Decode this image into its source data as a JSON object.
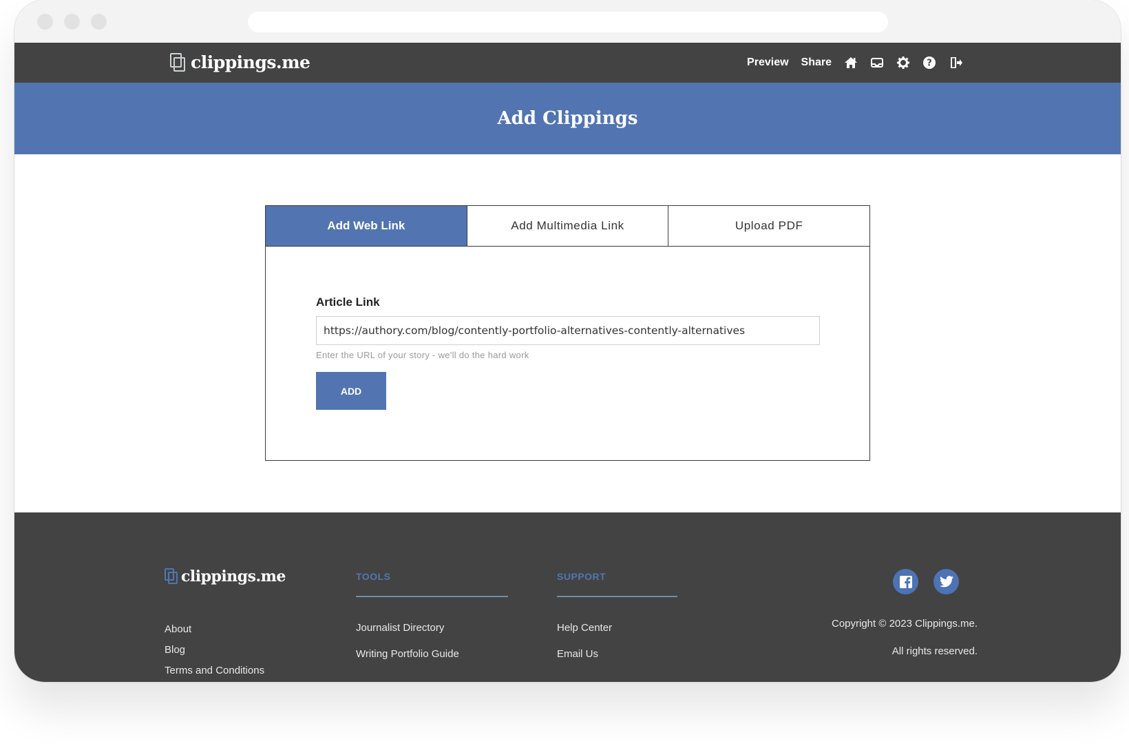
{
  "brand": {
    "name": "clippings.me"
  },
  "nav": {
    "links": [
      "Preview",
      "Share"
    ],
    "icons": [
      "home-icon",
      "inbox-icon",
      "gear-icon",
      "help-icon",
      "logout-icon"
    ]
  },
  "hero": {
    "title": "Add Clippings"
  },
  "tabs": [
    {
      "label": "Add Web Link",
      "active": true
    },
    {
      "label": "Add Multimedia Link",
      "active": false
    },
    {
      "label": "Upload PDF",
      "active": false
    }
  ],
  "form": {
    "label": "Article Link",
    "value": "https://authory.com/blog/contently-portfolio-alternatives-contently-alternatives",
    "hint": "Enter the URL of your story - we'll do the hard work",
    "button": "ADD"
  },
  "footer": {
    "links": [
      "About",
      "Blog",
      "Terms and Conditions"
    ],
    "tools": {
      "heading": "TOOLS",
      "items": [
        "Journalist Directory",
        "Writing Portfolio Guide"
      ]
    },
    "support": {
      "heading": "SUPPORT",
      "items": [
        "Help Center",
        "Email Us"
      ]
    },
    "social": [
      "facebook-icon",
      "twitter-icon"
    ],
    "copyright": [
      "Copyright © 2023 Clippings.me.",
      "All rights reserved."
    ]
  },
  "colors": {
    "accent": "#5275b1",
    "nav_bg": "#424342",
    "footer_bg": "#424342"
  }
}
